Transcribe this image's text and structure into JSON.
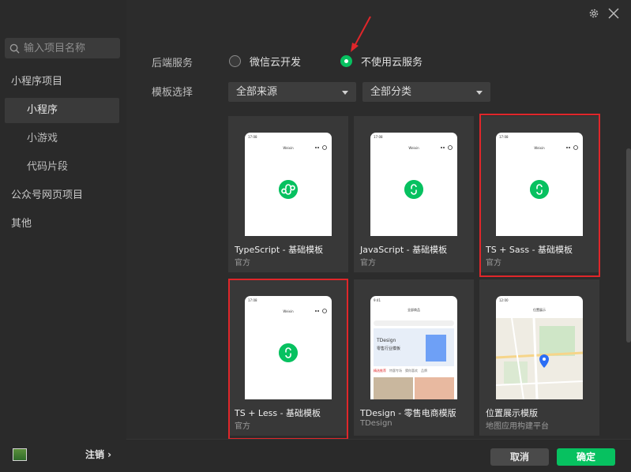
{
  "sidebar": {
    "search_placeholder": "输入项目名称",
    "items": [
      {
        "label": "小程序项目"
      },
      {
        "label": "小程序"
      },
      {
        "label": "小游戏"
      },
      {
        "label": "代码片段"
      },
      {
        "label": "公众号网页项目"
      },
      {
        "label": "其他"
      }
    ],
    "logout_label": "注销 ›"
  },
  "form": {
    "backend_label": "后端服务",
    "backend_options": [
      {
        "label": "微信云开发",
        "checked": false
      },
      {
        "label": "不使用云服务",
        "checked": true
      }
    ],
    "template_label": "模板选择",
    "source_select": "全部来源",
    "category_select": "全部分类"
  },
  "templates": [
    {
      "name": "TypeScript - 基础模板",
      "sub": "官方",
      "phone_title": "Weixin",
      "status": "17:08",
      "highlighted": false
    },
    {
      "name": "JavaScript - 基础模板",
      "sub": "官方",
      "phone_title": "Weixin",
      "status": "17:08",
      "highlighted": false
    },
    {
      "name": "TS + Sass - 基础模板",
      "sub": "官方",
      "phone_title": "Weixin",
      "status": "17:08",
      "highlighted": true
    },
    {
      "name": "TS + Less - 基础模板",
      "sub": "官方",
      "phone_title": "Weixin",
      "status": "17:08",
      "highlighted": true
    },
    {
      "name": "TDesign - 零售电商模版",
      "sub": "TDesign",
      "phone_title": "全部商品",
      "status": "9:41",
      "banner": "TDesign",
      "banner2": "零售行业模板",
      "tabs": [
        "精选推荐",
        "特惠专场",
        "猜你喜欢",
        "品牌"
      ],
      "highlighted": false
    },
    {
      "name": "位置展示模版",
      "sub": "地图应用构建平台",
      "phone_title": "位置展示",
      "status": "12:00",
      "highlighted": false
    }
  ],
  "footer": {
    "cancel_label": "取消",
    "ok_label": "确定"
  },
  "colors": {
    "accent": "#07c160",
    "highlight": "#e0262a",
    "background": "#2c2c2c"
  }
}
